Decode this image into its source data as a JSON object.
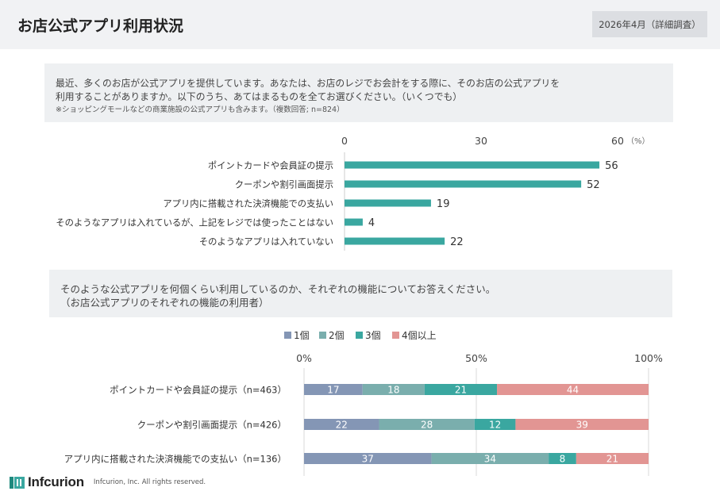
{
  "header": {
    "title": "お店公式アプリ利用状況",
    "date_badge": "2026年4月（詳細調査）"
  },
  "question1": {
    "line1": "最近、多くのお店が公式アプリを提供しています。あなたは、お店のレジでお会計をする際に、そのお店の公式アプリを",
    "line2": "利用することがありますか。以下のうち、あてはまるものを全てお選びください。（いくつでも）",
    "note": "※ショッピングモールなどの商業施設の公式アプリも含みます。（複数回答; n=824）"
  },
  "question2": {
    "line1": "そのような公式アプリを何個くらい利用しているのか、それぞれの機能についてお答えください。",
    "line2": "（お店公式アプリのそれぞれの機能の利用者）"
  },
  "chart_data": [
    {
      "type": "bar",
      "orientation": "horizontal",
      "categories": [
        "ポイントカードや会員証の提示",
        "クーポンや割引画面提示",
        "アプリ内に搭載された決済機能での支払い",
        "そのようなアプリは入れているが、上記をレジでは使ったことはない",
        "そのようなアプリは入れていない"
      ],
      "values": [
        56,
        52,
        19,
        4,
        22
      ],
      "ticks": [
        "0",
        "30",
        "60"
      ],
      "unit": "（%）",
      "xlim": [
        0,
        60
      ],
      "color": "#3aa7a0",
      "grid": false
    },
    {
      "type": "bar",
      "orientation": "horizontal",
      "stacked": "percent",
      "categories": [
        "ポイントカードや会員証の提示（n=463）",
        "クーポンや割引画面提示（n=426）",
        "アプリ内に搭載された決済機能での支払い（n=136）"
      ],
      "series": [
        {
          "name": "1個",
          "values": [
            17,
            22,
            37
          ],
          "color": "#8496b5"
        },
        {
          "name": "2個",
          "values": [
            18,
            28,
            34
          ],
          "color": "#7aaead"
        },
        {
          "name": "3個",
          "values": [
            21,
            12,
            8
          ],
          "color": "#3aa7a0"
        },
        {
          "name": "4個以上",
          "values": [
            44,
            39,
            21
          ],
          "color": "#e29593"
        }
      ],
      "ticks": [
        "0%",
        "50%",
        "100%"
      ],
      "xlim": [
        0,
        100
      ],
      "legend_position": "top",
      "grid": true
    }
  ],
  "footer": {
    "logo_text": "Infcurion",
    "copyright": "Infcurion, Inc.  All rights reserved."
  }
}
